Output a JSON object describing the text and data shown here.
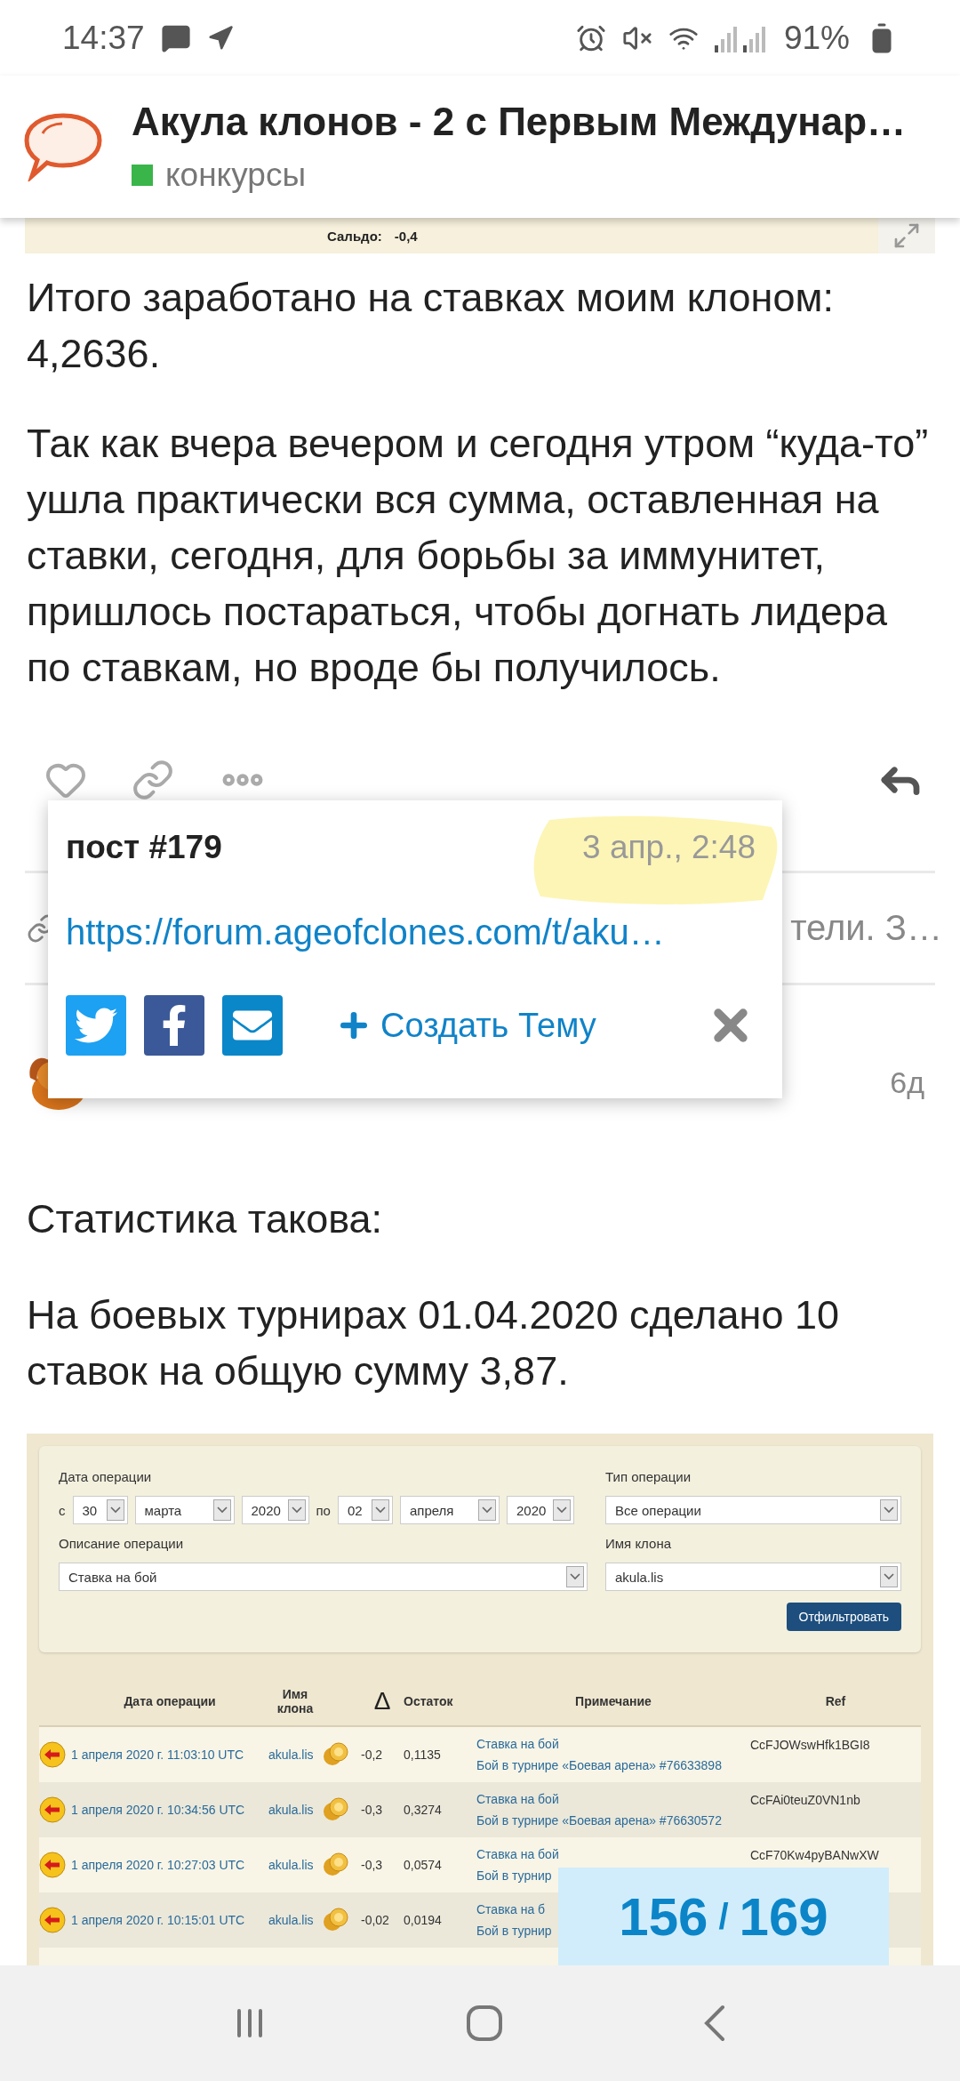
{
  "status_bar": {
    "time": "14:37",
    "battery": "91%"
  },
  "header": {
    "title": "Акула клонов - 2 с Первым Междунар…",
    "category": {
      "label": "конкурсы",
      "color": "#3ab54a"
    }
  },
  "top_image": {
    "balance_label": "Сальдо:",
    "balance_value": "-0,4"
  },
  "post_paragraphs": [
    "Итого заработано на ставках моим клоном: 4,2636.",
    "Так как вчера вечером и сегодня утром “куда-то” ушла практически вся сумма, оставленная на ставки, сегодня, для борьбы за иммунитет, пришлось постараться, чтобы догнать лидера по ставкам, но вроде бы получилось."
  ],
  "link_row": {
    "text": "тели. З…"
  },
  "share_popup": {
    "title": "пост #179",
    "date": "3 апр., 2:48",
    "url": "https://forum.ageofclones.com/t/aku…",
    "create_topic": "Создать Тему"
  },
  "next_post": {
    "age": "6д",
    "paragraphs": [
      "Статистика такова:",
      "На боевых турнирах 01.04.2020 сделано 10 ставок на общую сумму 3,87."
    ]
  },
  "embedded_screenshot": {
    "form": {
      "date_label": "Дата операции",
      "from_label": "с",
      "from": [
        "30",
        "марта",
        "2020"
      ],
      "to_label": "по",
      "to": [
        "02",
        "апреля",
        "2020"
      ],
      "type_label": "Тип операции",
      "type_value": "Все операции",
      "description_label": "Описание операции",
      "description_value": "Ставка на бой",
      "clone_label": "Имя клона",
      "clone_value": "akula.lis",
      "filter_button": "Отфильтровать"
    },
    "table": {
      "columns": [
        "Дата операции",
        "Имя клона",
        "Δ",
        "Остаток",
        "Примечание",
        "Ref"
      ],
      "rows": [
        {
          "date": "1 апреля 2020 г. 11:03:10 UTC",
          "clone": "akula.lis",
          "delta": "-0,2",
          "balance": "0,1135",
          "note_title": "Ставка на бой",
          "note_detail": "Бой в турнире «Боевая арена» #76633898",
          "ref": "CcFJOWswHfk1BGI8"
        },
        {
          "date": "1 апреля 2020 г. 10:34:56 UTC",
          "clone": "akula.lis",
          "delta": "-0,3",
          "balance": "0,3274",
          "note_title": "Ставка на бой",
          "note_detail": "Бой в турнире «Боевая арена» #76630572",
          "ref": "CcFAi0teuZ0VN1nb"
        },
        {
          "date": "1 апреля 2020 г. 10:27:03 UTC",
          "clone": "akula.lis",
          "delta": "-0,3",
          "balance": "0,0574",
          "note_title": "Ставка на бой",
          "note_detail": "Бой в турнир",
          "ref": "CcF70Kw4pyBANwXW"
        },
        {
          "date": "1 апреля 2020 г. 10:15:01 UTC",
          "clone": "akula.lis",
          "delta": "-0,02",
          "balance": "0,0194",
          "note_title": "Ставка на б",
          "note_detail": "Бой в турнир"
        }
      ]
    }
  },
  "progress_counter": {
    "current": "156",
    "separator": "/",
    "total": "169"
  }
}
